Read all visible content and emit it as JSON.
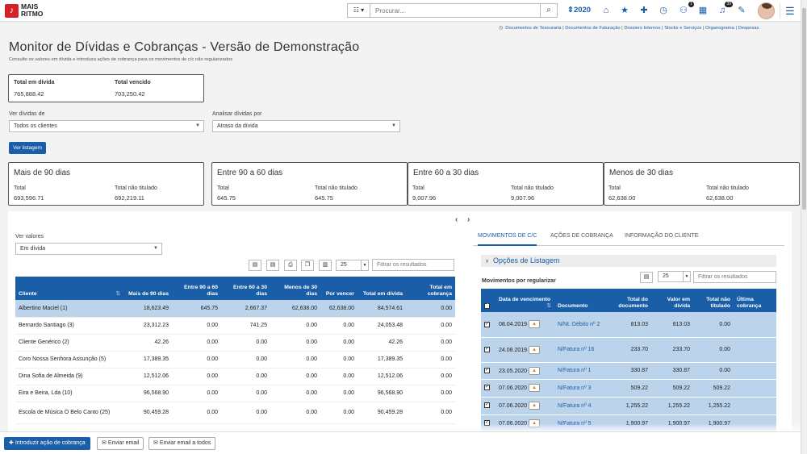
{
  "app": {
    "logo_line1": "MAIS",
    "logo_line2": "RITMO",
    "logo_mark": "♪"
  },
  "search": {
    "placeholder": "Procurar...",
    "dropdown": "☷ ▾"
  },
  "year": "⇕2020",
  "top_icons": [
    {
      "name": "home-icon",
      "glyph": "⌂"
    },
    {
      "name": "star-icon",
      "glyph": "★"
    },
    {
      "name": "plus-icon",
      "glyph": "✚"
    },
    {
      "name": "clock-icon",
      "glyph": "◷"
    },
    {
      "name": "users-icon",
      "glyph": "⚇",
      "badge": "1"
    },
    {
      "name": "calendar-icon",
      "glyph": "▦"
    },
    {
      "name": "bell-icon",
      "glyph": "♫",
      "badge": "39"
    },
    {
      "name": "wrench-icon",
      "glyph": "✎"
    }
  ],
  "quick_links": [
    "Documentos de Tesouraria",
    "Documentos de Faturação",
    "Dossiers Internos",
    "Stocks e Serviços",
    "Organograma",
    "Despesas"
  ],
  "page": {
    "title": "Monitor de Dívidas e Cobranças - Versão de Demonstração",
    "subtitle": "Consulte os valores em dívida e introduza ações de cobrança para os movimentos de c/c não regularizados"
  },
  "summary": {
    "total_divida_label": "Total em dívida",
    "total_divida": "765,888.42",
    "total_vencido_label": "Total vencido",
    "total_vencido": "703,250.42"
  },
  "filters": {
    "ver_dividas_label": "Ver dívidas de",
    "ver_dividas_value": "Todos os clientes",
    "analisar_label": "Analisar dívidas por",
    "analisar_value": "Atraso da dívida",
    "ver_listagem": "Ver listagem"
  },
  "cards": [
    {
      "title": "Mais de 90 dias",
      "total_label": "Total",
      "total": "693,596.71",
      "nt_label": "Total não titulado",
      "nt": "692,219.11"
    },
    {
      "title": "Entre 90 a 60 dias",
      "total_label": "Total",
      "total": "645.75",
      "nt_label": "Total não titulado",
      "nt": "645.75"
    },
    {
      "title": "Entre 60 a 30 dias",
      "total_label": "Total",
      "total": "9,007.96",
      "nt_label": "Total não titulado",
      "nt": "9,007.96"
    },
    {
      "title": "Menos de 30 dias",
      "total_label": "Total",
      "total": "62,638.00",
      "nt_label": "Total não titulado",
      "nt": "62,638.00"
    }
  ],
  "left": {
    "ver_valores_label": "Ver valores",
    "ver_valores_value": "Em dívida",
    "page_size": "25",
    "filter_placeholder": "Filtrar os resultados",
    "columns": [
      "Cliente",
      "Mais de 90 dias",
      "Entre 90 a 60 dias",
      "Entre 60 a 30 dias",
      "Menos de 30 dias",
      "Por vencer",
      "Total em dívida",
      "Total em cobrança"
    ],
    "rows": [
      [
        "Albertino Maciel (1)",
        "18,623.49",
        "645.75",
        "2,667.37",
        "62,638.00",
        "62,638.00",
        "84,574.61",
        "0.00"
      ],
      [
        "Bernardo Santiago (3)",
        "23,312.23",
        "0.00",
        "741.25",
        "0.00",
        "0.00",
        "24,053.48",
        "0.00"
      ],
      [
        "Cliente Genérico (2)",
        "42.26",
        "0.00",
        "0.00",
        "0.00",
        "0.00",
        "42.26",
        "0.00"
      ],
      [
        "Coro Nossa Senhora Assunção (5)",
        "17,389.35",
        "0.00",
        "0.00",
        "0.00",
        "0.00",
        "17,389.35",
        "0.00"
      ],
      [
        "Dina Sofia de Almeida (9)",
        "12,512.06",
        "0.00",
        "0.00",
        "0.00",
        "0.00",
        "12,512.06",
        "0.00"
      ],
      [
        "Eira e Beira, Lda (10)",
        "96,568.90",
        "0.00",
        "0.00",
        "0.00",
        "0.00",
        "96,568.90",
        "0.00"
      ],
      [
        "Escola de Música O Belo Canto (25)",
        "90,459.28",
        "0.00",
        "0.00",
        "0.00",
        "0.00",
        "90,459.28",
        "0.00"
      ]
    ]
  },
  "right": {
    "tabs": [
      "MOVIMENTOS DE C/C",
      "AÇÕES DE COBRANÇA",
      "INFORMAÇÃO DO CLIENTE"
    ],
    "opcoes": "Opções de Listagem",
    "mov_title": "Movimentos por regularizar",
    "page_size": "25",
    "filter_placeholder": "Filtrar os resultados",
    "columns": [
      "Data de vencimento",
      "Documento",
      "Total do documento",
      "Valor em dívida",
      "Total não titulado",
      "Última cobrança"
    ],
    "rows": [
      [
        "08.04.2019",
        "N/Nt. Débito nº 2",
        "813.03",
        "813.03",
        "0.00",
        ""
      ],
      [
        "24.08.2019",
        "N/Fatura nº 16",
        "233.70",
        "233.70",
        "0.00",
        ""
      ],
      [
        "23.05.2020",
        "N/Fatura nº 1",
        "330.87",
        "330.87",
        "0.00",
        ""
      ],
      [
        "07.06.2020",
        "N/Fatura nº 3",
        "509.22",
        "509.22",
        "509.22",
        ""
      ],
      [
        "07.06.2020",
        "N/Fatura nº 4",
        "1,255.22",
        "1,255.22",
        "1,255.22",
        ""
      ],
      [
        "07.06.2020",
        "N/Fatura nº 5",
        "1,900.97",
        "1,900.97",
        "1,900.97",
        ""
      ]
    ]
  },
  "bottom": {
    "introduzir": "Introduzir ação de cobrança",
    "enviar": "Enviar email",
    "enviar_todos": "Enviar email a todos"
  },
  "colors": {
    "primary": "#1a5ea8",
    "selected_row": "#bcd3ec",
    "logo": "#d42127",
    "warn": "#e07a14"
  }
}
